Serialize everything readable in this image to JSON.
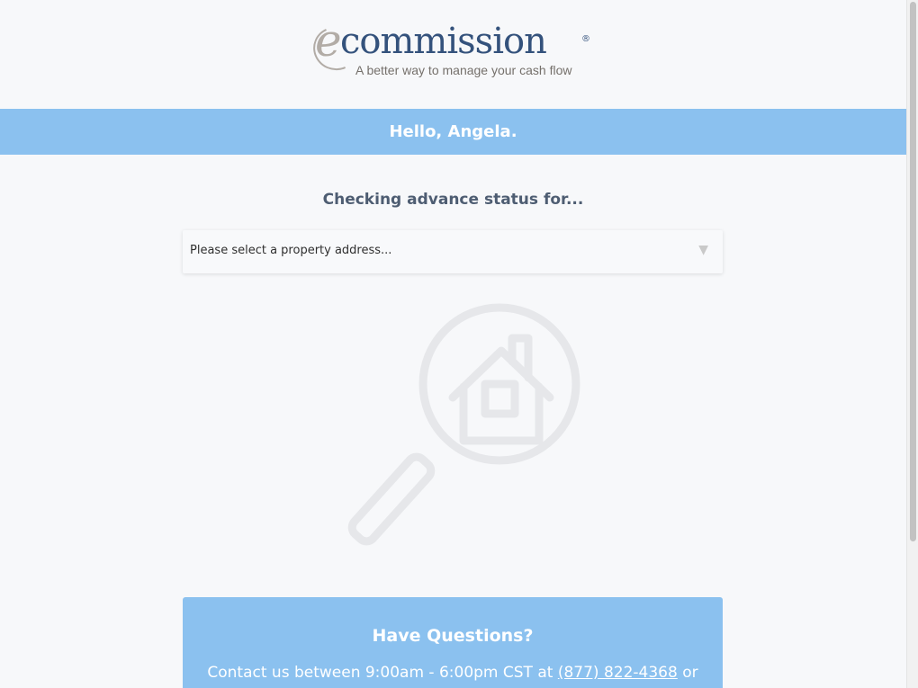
{
  "brand": {
    "logo_e": "e",
    "logo_word": "commission",
    "logo_reg": "®",
    "tagline": "A better way to manage your cash flow"
  },
  "greeting": "Hello, Angela.",
  "status": {
    "label": "Checking advance status for...",
    "select_placeholder": "Please select a property address...",
    "select_arrow": "▼"
  },
  "illustration": {
    "icon": "house-magnifier-icon"
  },
  "questions": {
    "title": "Have Questions?",
    "contact_prefix": "Contact us between 9:00am - 6:00pm CST at ",
    "phone": "(877) 822-4368",
    "contact_suffix": " or"
  },
  "colors": {
    "accent_blue": "#8bc1ef",
    "brand_navy": "#34527c",
    "brand_gray": "#b2aca6",
    "illustration_gray": "#e6e7ea"
  }
}
